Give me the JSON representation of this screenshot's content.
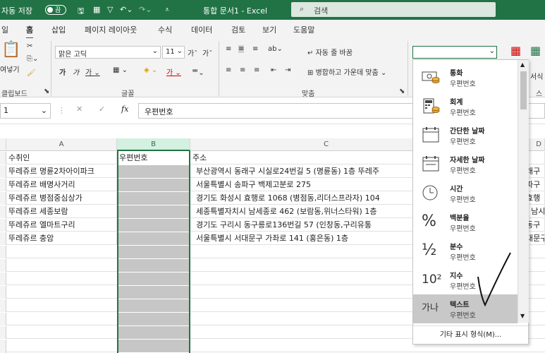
{
  "titlebar": {
    "autosave": "자동 저장",
    "toggle": "끔",
    "doc_title": "통합 문서1 - Excel",
    "search_placeholder": "검색"
  },
  "tabs": [
    "일",
    "홈",
    "삽입",
    "페이지 레이아웃",
    "수식",
    "데이터",
    "검토",
    "보기",
    "도움말"
  ],
  "ribbon": {
    "paste": "여넣기",
    "clipboard": "클립보드",
    "font_name": "맑은 고딕",
    "font_size": "11",
    "font_group": "글꼴",
    "wrap_text": "자동 줄 바꿈",
    "merge_center": "병합하고 가운데 맞춤",
    "align_group": "맞춤",
    "number_format": "",
    "cut_right": "서식",
    "style_group": "스"
  },
  "formula_bar": {
    "name_box": "1",
    "fx": "fx",
    "value": "우편번호"
  },
  "columns": [
    "A",
    "B",
    "C",
    "D"
  ],
  "rows": [
    {
      "a": "수취인",
      "b": "우편번호",
      "c": "주소",
      "d": ""
    },
    {
      "a": "뚜레쥬르 명륜2차아이파크",
      "b": "",
      "c": "부산광역시 동래구 시실로24번길 5 (명륜동) 1층 뚜레주",
      "d": "래구"
    },
    {
      "a": "뚜레쥬르 배명사거리",
      "b": "",
      "c": "서울특별시 송파구 백제고분로 275",
      "d": "파구"
    },
    {
      "a": "뚜레쥬르 병점중심상가",
      "b": "",
      "c": "경기도 화성시 효행로 1068 (병점동,리더스프라자) 104",
      "d": "효행"
    },
    {
      "a": "뚜레쥬르 세종보람",
      "b": "",
      "c": "세종특별자치시 남세종로 462 (보람동,위너스타워) 1층",
      "d": "| 남시"
    },
    {
      "a": "뚜레쥬르 엘마트구리",
      "b": "",
      "c": "경기도 구리시 동구릉로136번길 57 (인창동,구리유통",
      "d": "동구"
    },
    {
      "a": "뚜레쥬르 충암",
      "b": "",
      "c": "서울특별시 서대문구 가좌로 141 (홍은동) 1층",
      "d": "대문구"
    }
  ],
  "menu": {
    "items": [
      {
        "name": "통화",
        "sub": "우편번호",
        "icon": "currency-icon"
      },
      {
        "name": "회계",
        "sub": "우편번호",
        "icon": "accounting-icon"
      },
      {
        "name": "간단한 날짜",
        "sub": "우편번호",
        "icon": "short-date-icon"
      },
      {
        "name": "자세한 날짜",
        "sub": "우편번호",
        "icon": "long-date-icon"
      },
      {
        "name": "시간",
        "sub": "우편번호",
        "icon": "clock-icon"
      },
      {
        "name": "백분율",
        "sub": "우편번호",
        "icon": "percent-icon"
      },
      {
        "name": "분수",
        "sub": "우편번호",
        "icon": "fraction-icon"
      },
      {
        "name": "지수",
        "sub": "우편번호",
        "icon": "scientific-icon"
      },
      {
        "name": "텍스트",
        "sub": "우편번호",
        "icon": "text-icon",
        "glyph": "가나"
      }
    ],
    "glyph_percent": "%",
    "glyph_fraction": "½",
    "glyph_sci": "10²",
    "more": "기타 표시 형식(M)..."
  }
}
